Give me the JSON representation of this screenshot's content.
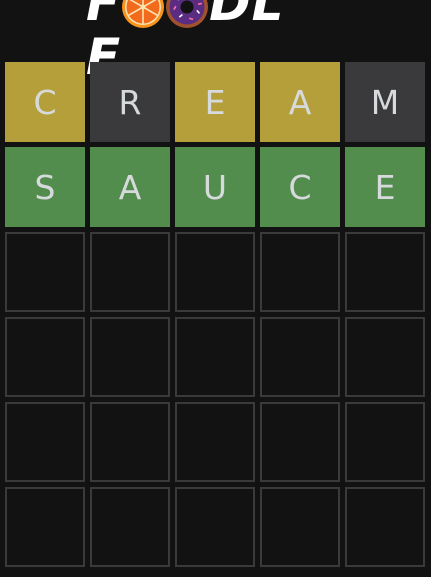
{
  "app": {
    "logo_letters": [
      "F",
      "",
      "",
      "D",
      "L",
      "E"
    ],
    "logo_food_icons": [
      "orange-slice-icon",
      "donut-icon"
    ]
  },
  "colors": {
    "background": "#121213",
    "correct": "#538d4e",
    "present": "#b59f3b",
    "absent": "#3a3a3c",
    "empty_border": "#3a3a3c"
  },
  "board": {
    "rows": [
      [
        {
          "letter": "C",
          "state": "present"
        },
        {
          "letter": "R",
          "state": "absent"
        },
        {
          "letter": "E",
          "state": "present"
        },
        {
          "letter": "A",
          "state": "present"
        },
        {
          "letter": "M",
          "state": "absent"
        }
      ],
      [
        {
          "letter": "S",
          "state": "correct"
        },
        {
          "letter": "A",
          "state": "correct"
        },
        {
          "letter": "U",
          "state": "correct"
        },
        {
          "letter": "C",
          "state": "correct"
        },
        {
          "letter": "E",
          "state": "correct"
        }
      ],
      [
        {
          "letter": "",
          "state": "empty"
        },
        {
          "letter": "",
          "state": "empty"
        },
        {
          "letter": "",
          "state": "empty"
        },
        {
          "letter": "",
          "state": "empty"
        },
        {
          "letter": "",
          "state": "empty"
        }
      ],
      [
        {
          "letter": "",
          "state": "empty"
        },
        {
          "letter": "",
          "state": "empty"
        },
        {
          "letter": "",
          "state": "empty"
        },
        {
          "letter": "",
          "state": "empty"
        },
        {
          "letter": "",
          "state": "empty"
        }
      ],
      [
        {
          "letter": "",
          "state": "empty"
        },
        {
          "letter": "",
          "state": "empty"
        },
        {
          "letter": "",
          "state": "empty"
        },
        {
          "letter": "",
          "state": "empty"
        },
        {
          "letter": "",
          "state": "empty"
        }
      ],
      [
        {
          "letter": "",
          "state": "empty"
        },
        {
          "letter": "",
          "state": "empty"
        },
        {
          "letter": "",
          "state": "empty"
        },
        {
          "letter": "",
          "state": "empty"
        },
        {
          "letter": "",
          "state": "empty"
        }
      ]
    ]
  }
}
